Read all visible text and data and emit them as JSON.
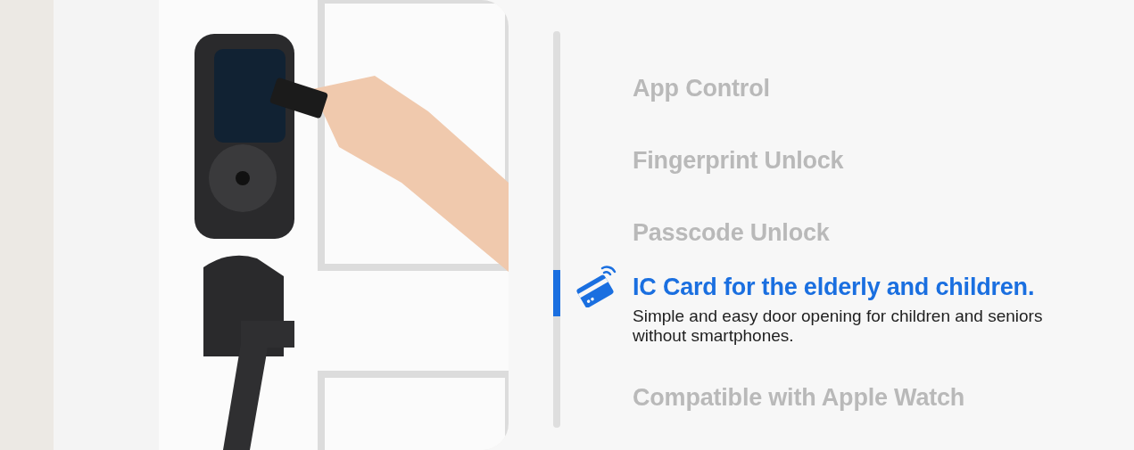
{
  "features": [
    {
      "title": "App Control",
      "selected": false
    },
    {
      "title": "Fingerprint Unlock",
      "selected": false
    },
    {
      "title": "Passcode Unlock",
      "selected": false
    },
    {
      "title": "IC Card for the elderly and children.",
      "selected": true,
      "description": "Simple and easy door opening for children and seniors without smartphones."
    },
    {
      "title": "Compatible with Apple Watch",
      "selected": false
    }
  ]
}
